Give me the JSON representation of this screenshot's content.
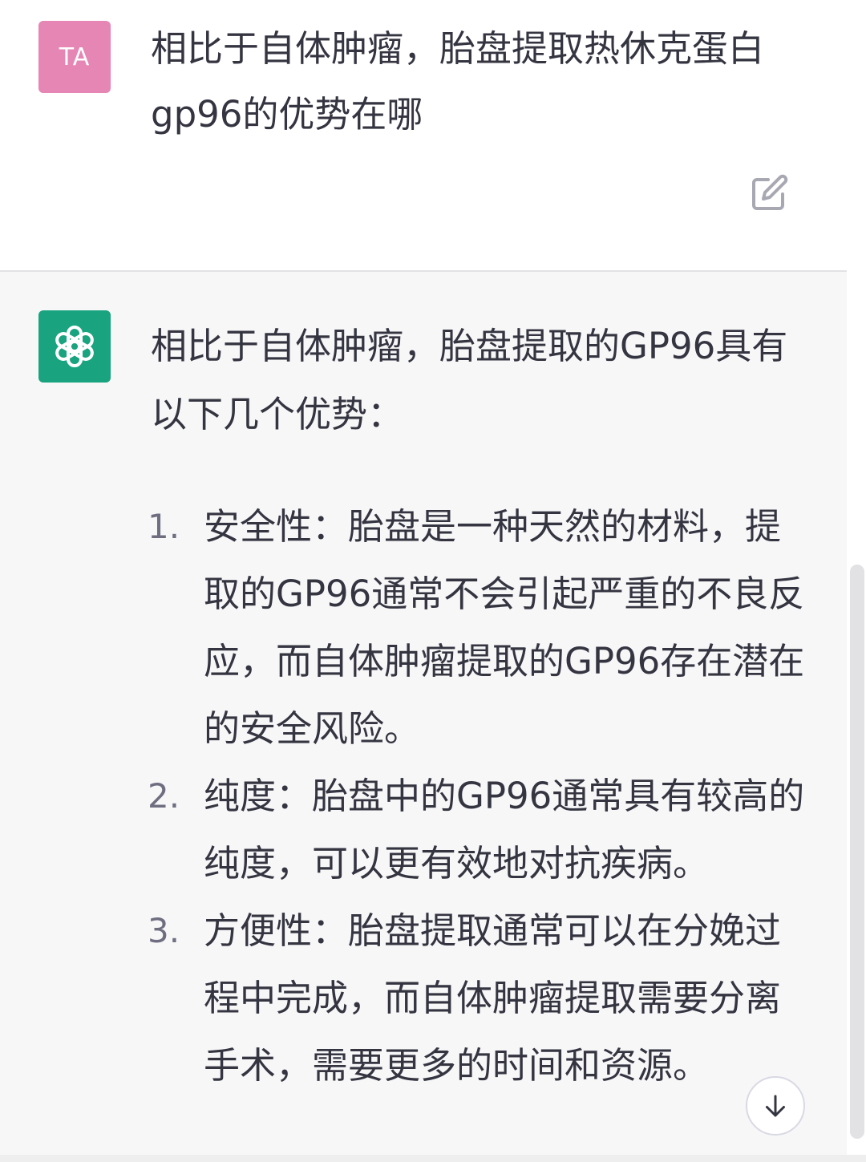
{
  "colors": {
    "user_avatar_bg": "#e586b5",
    "assistant_avatar_bg": "#19a37f",
    "assistant_message_bg": "#f7f7f8",
    "text": "#343541"
  },
  "user_message": {
    "avatar_initials": "TA",
    "text": "相比于自体肿瘤，胎盘提取热休克蛋白gp96的优势在哪",
    "edit_icon": "edit-icon"
  },
  "assistant_message": {
    "avatar_icon": "openai-logo-icon",
    "intro": "相比于自体肿瘤，胎盘提取的GP96具有以下几个优势：",
    "items": [
      {
        "number": "1.",
        "text": "安全性：胎盘是一种天然的材料，提取的GP96通常不会引起严重的不良反应，而自体肿瘤提取的GP96存在潜在的安全风险。"
      },
      {
        "number": "2.",
        "text": "纯度：胎盘中的GP96通常具有较高的纯度，可以更有效地对抗疾病。"
      },
      {
        "number": "3.",
        "text": "方便性：胎盘提取通常可以在分娩过程中完成，而自体肿瘤提取需要分离手术，需要更多的时间和资源。"
      }
    ]
  },
  "scroll_down_icon": "arrow-down-icon"
}
